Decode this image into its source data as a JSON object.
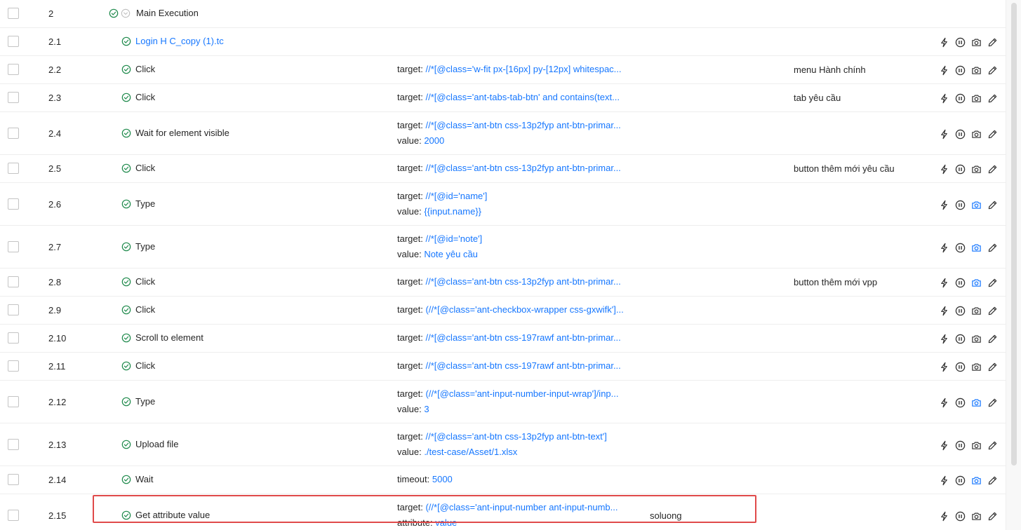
{
  "rows": [
    {
      "no": "2",
      "name": "Main Execution",
      "parent": true,
      "params": [],
      "desc": "",
      "var": "",
      "height": 40,
      "actions": false
    },
    {
      "no": "2.1",
      "name": "Login H C_copy (1).tc",
      "link": true,
      "params": [],
      "desc": "",
      "var": "",
      "height": 40,
      "actions": true
    },
    {
      "no": "2.2",
      "name": "Click",
      "params": [
        {
          "label": "target: ",
          "value": "//*[@class='w-fit px-[16px] py-[12px] whitespac..."
        }
      ],
      "desc": "menu Hành chính",
      "var": "",
      "height": 40,
      "actions": true
    },
    {
      "no": "2.3",
      "name": "Click",
      "params": [
        {
          "label": "target: ",
          "value": "//*[@class='ant-tabs-tab-btn' and contains(text..."
        }
      ],
      "desc": "tab yêu cầu",
      "var": "",
      "height": 40,
      "actions": true
    },
    {
      "no": "2.4",
      "name": "Wait for element visible",
      "params": [
        {
          "label": "target: ",
          "value": "//*[@class='ant-btn css-13p2fyp ant-btn-primar..."
        },
        {
          "label": "value: ",
          "value": "2000"
        }
      ],
      "desc": "",
      "var": "",
      "height": 61,
      "actions": true
    },
    {
      "no": "2.5",
      "name": "Click",
      "params": [
        {
          "label": "target: ",
          "value": "//*[@class='ant-btn css-13p2fyp ant-btn-primar..."
        }
      ],
      "desc": "button thêm mới yêu cầu",
      "var": "",
      "height": 40,
      "actions": true
    },
    {
      "no": "2.6",
      "name": "Type",
      "params": [
        {
          "label": "target: ",
          "value": "//*[@id='name']"
        },
        {
          "label": "value: ",
          "value": "{{input.name}}"
        }
      ],
      "desc": "",
      "var": "",
      "height": 61,
      "actions": true,
      "camActive": true
    },
    {
      "no": "2.7",
      "name": "Type",
      "params": [
        {
          "label": "target: ",
          "value": "//*[@id='note']"
        },
        {
          "label": "value: ",
          "value": "Note yêu cầu"
        }
      ],
      "desc": "",
      "var": "",
      "height": 61,
      "actions": true,
      "camActive": true
    },
    {
      "no": "2.8",
      "name": "Click",
      "params": [
        {
          "label": "target: ",
          "value": "//*[@class='ant-btn css-13p2fyp ant-btn-primar..."
        }
      ],
      "desc": "button thêm mới vpp",
      "var": "",
      "height": 40,
      "actions": true,
      "camActive": true
    },
    {
      "no": "2.9",
      "name": "Click",
      "params": [
        {
          "label": "target: ",
          "value": "(//*[@class='ant-checkbox-wrapper css-gxwifk']..."
        }
      ],
      "desc": "",
      "var": "",
      "height": 40,
      "actions": true
    },
    {
      "no": "2.10",
      "name": "Scroll to element",
      "params": [
        {
          "label": "target: ",
          "value": "//*[@class='ant-btn css-197rawf ant-btn-primar..."
        }
      ],
      "desc": "",
      "var": "",
      "height": 40,
      "actions": true
    },
    {
      "no": "2.11",
      "name": "Click",
      "params": [
        {
          "label": "target: ",
          "value": "//*[@class='ant-btn css-197rawf ant-btn-primar..."
        }
      ],
      "desc": "",
      "var": "",
      "height": 40,
      "actions": true
    },
    {
      "no": "2.12",
      "name": "Type",
      "params": [
        {
          "label": "target: ",
          "value": "(//*[@class='ant-input-number-input-wrap']/inp..."
        },
        {
          "label": "value: ",
          "value": "3"
        }
      ],
      "desc": "",
      "var": "",
      "height": 61,
      "actions": true,
      "camActive": true
    },
    {
      "no": "2.13",
      "name": "Upload file",
      "params": [
        {
          "label": "target: ",
          "value": "//*[@class='ant-btn css-13p2fyp ant-btn-text']"
        },
        {
          "label": "value: ",
          "value": "./test-case/Asset/1.xlsx"
        }
      ],
      "desc": "",
      "var": "",
      "height": 61,
      "actions": true
    },
    {
      "no": "2.14",
      "name": "Wait",
      "params": [
        {
          "label": "timeout: ",
          "value": "5000"
        }
      ],
      "desc": "",
      "var": "",
      "height": 40,
      "actions": true,
      "camActive": true
    },
    {
      "no": "2.15",
      "name": "Get attribute value",
      "params": [
        {
          "label": "target: ",
          "value": "(//*[@class='ant-input-number ant-input-numb..."
        },
        {
          "label": "attribute: ",
          "value": "value"
        }
      ],
      "desc": "",
      "var": "soluong",
      "height": 61,
      "actions": true,
      "highlighted": true
    }
  ],
  "icons": {
    "status": "check-circle-icon",
    "expand": "chevron-down-circle-icon",
    "run": "lightning-icon",
    "pause": "pause-circle-icon",
    "screenshot": "camera-icon",
    "edit": "pencil-icon"
  },
  "colors": {
    "success": "#1f8a4c",
    "link": "#1677ff",
    "highlight": "#e04a4a"
  }
}
